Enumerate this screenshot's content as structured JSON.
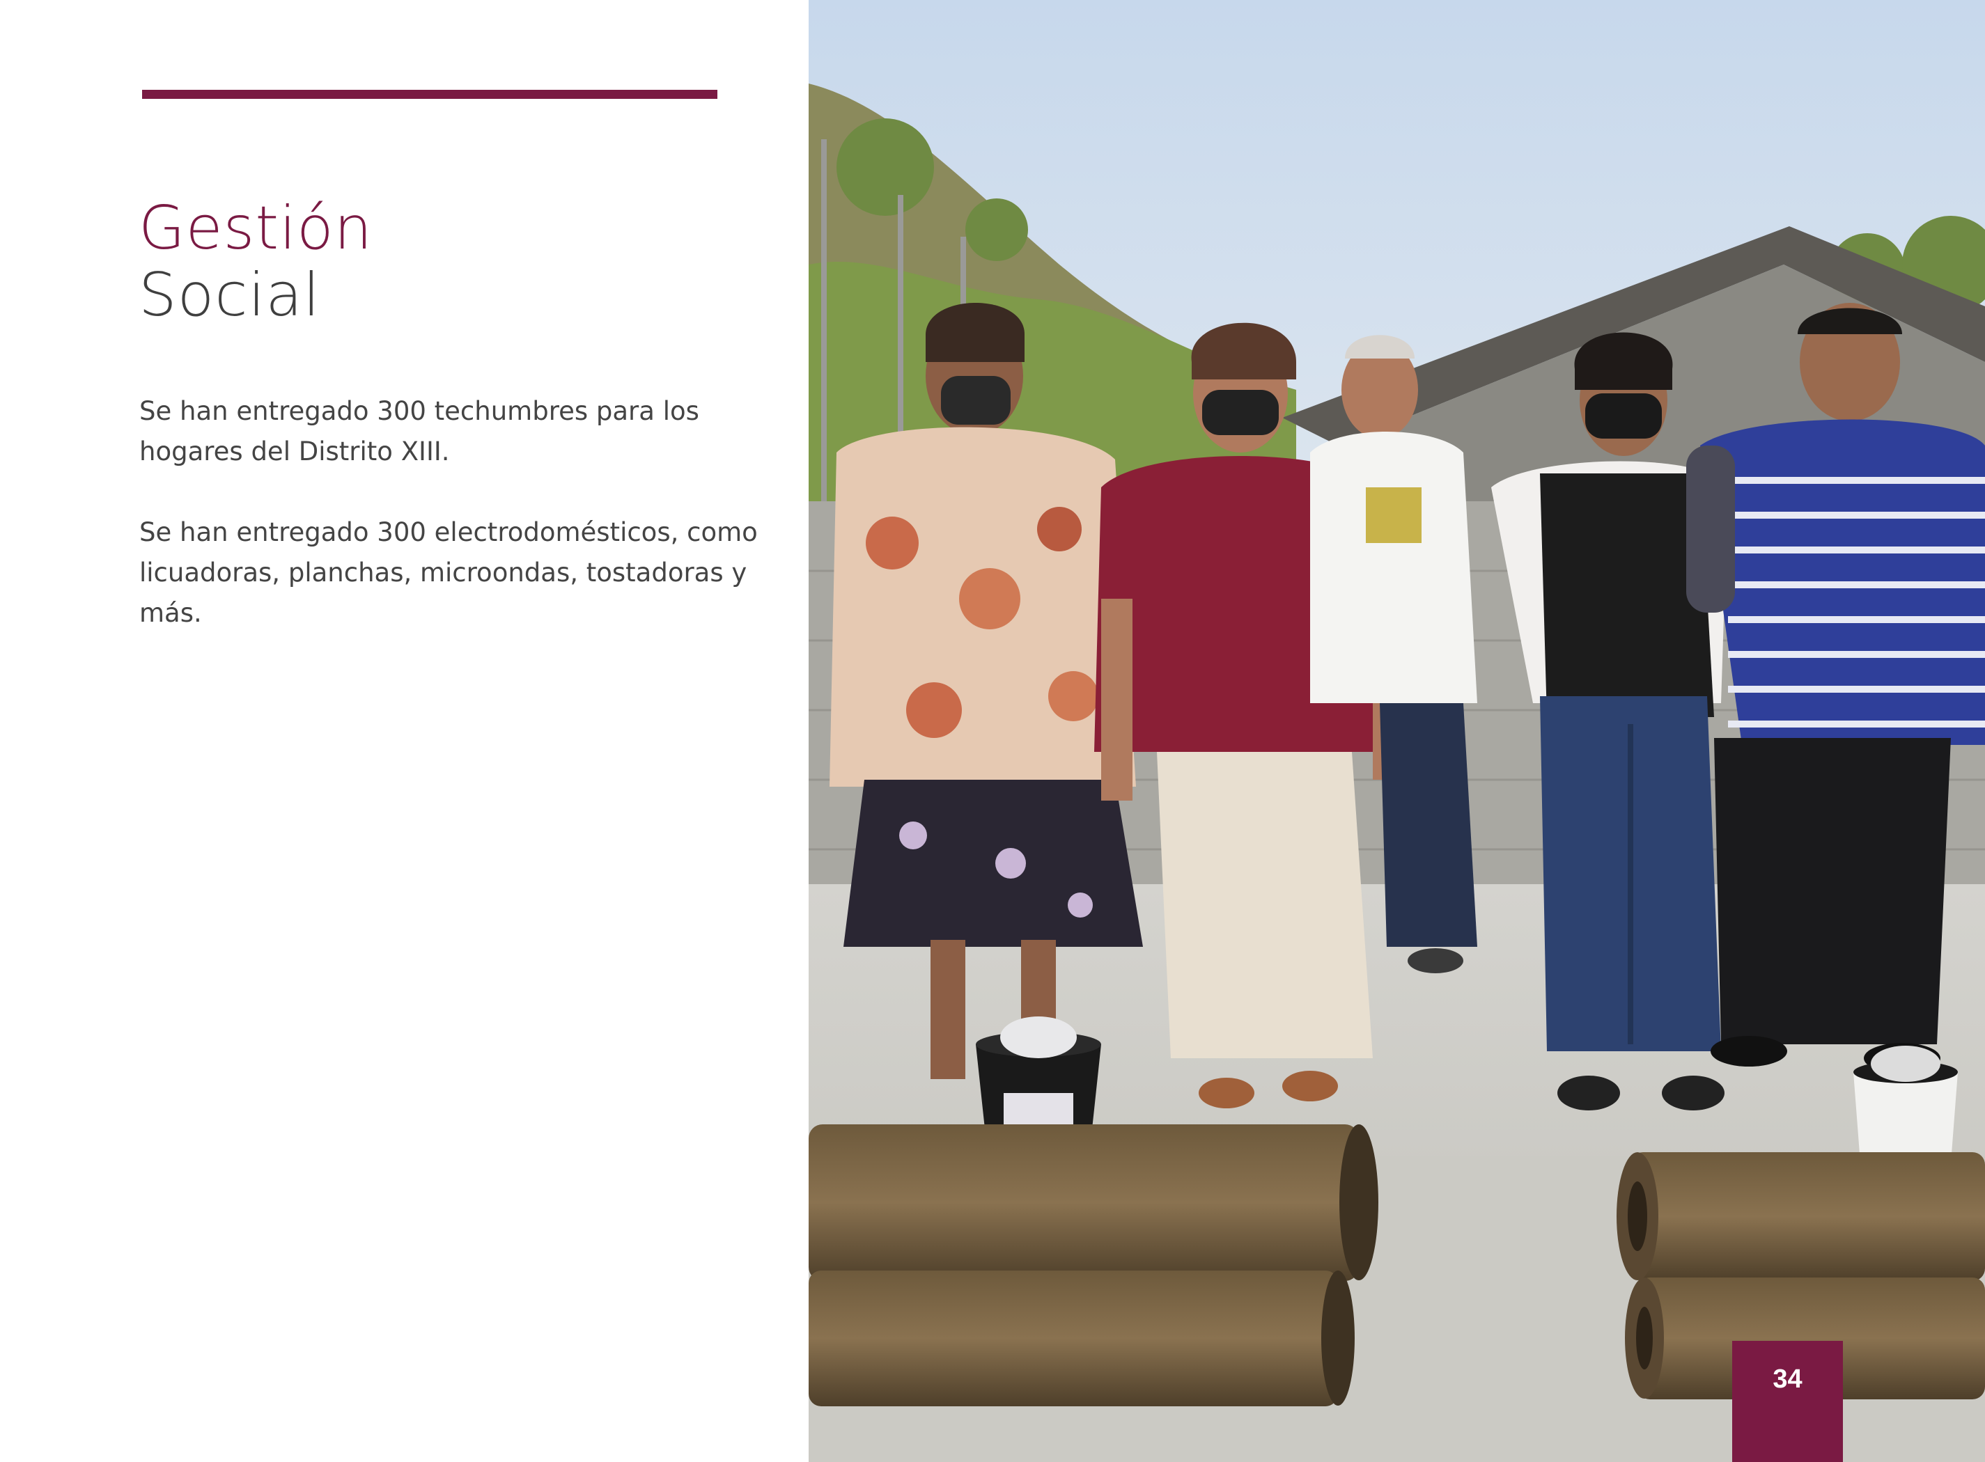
{
  "title": {
    "line1": "Gestión",
    "line2": "Social"
  },
  "body": {
    "paragraph1": "Se han entregado 300 techumbres para los hogares del Distrito XIII.",
    "paragraph2": "Se han entregado 300 electrodomésticos, como licuadoras, planchas, microondas, tostadoras y más."
  },
  "page_number": "34",
  "colors": {
    "accent": "#7a1a43",
    "title_secondary": "#3f3f3f",
    "body_text": "#444444"
  }
}
